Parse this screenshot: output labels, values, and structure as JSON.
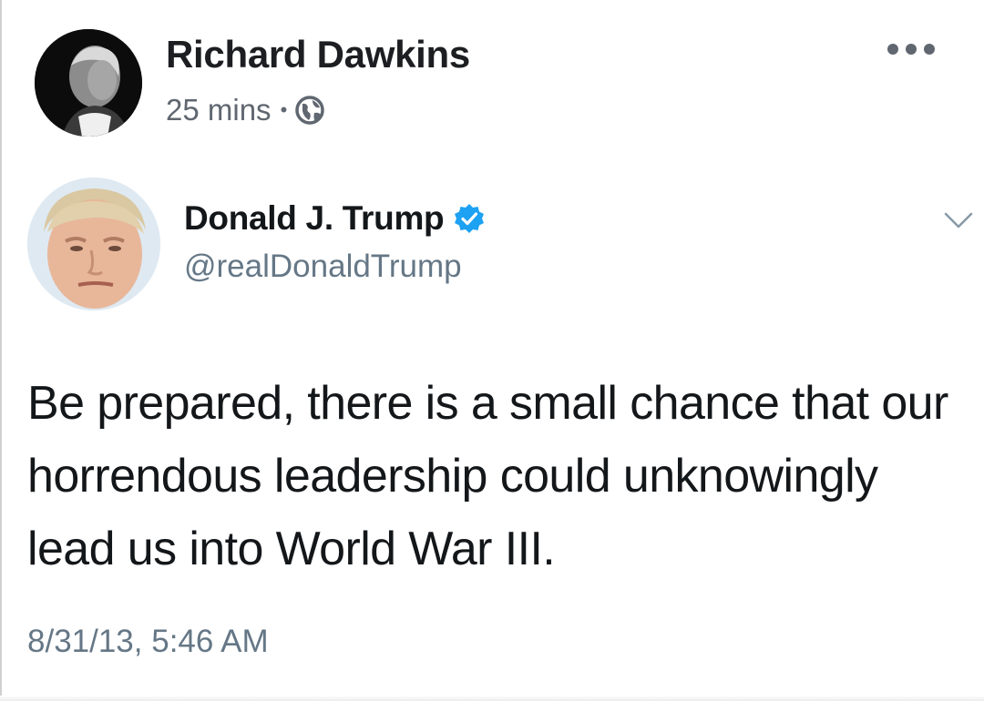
{
  "post": {
    "author": "Richard Dawkins",
    "time": "25 mins",
    "separator": "•",
    "audience_icon": "globe-icon",
    "menu_icon": "more-options-icon"
  },
  "tweet": {
    "name": "Donald J. Trump",
    "verified_icon": "verified-badge-icon",
    "handle": "@realDonaldTrump",
    "text": "Be prepared, there is a small chance that our horrendous leadership could unknowingly lead us into World War III.",
    "timestamp": "8/31/13, 5:46 AM",
    "menu_icon": "chevron-down-icon"
  },
  "colors": {
    "name_text": "#1c1e21",
    "meta_text": "#606770",
    "tweet_secondary": "#657786",
    "verified_blue": "#1da1f2"
  }
}
